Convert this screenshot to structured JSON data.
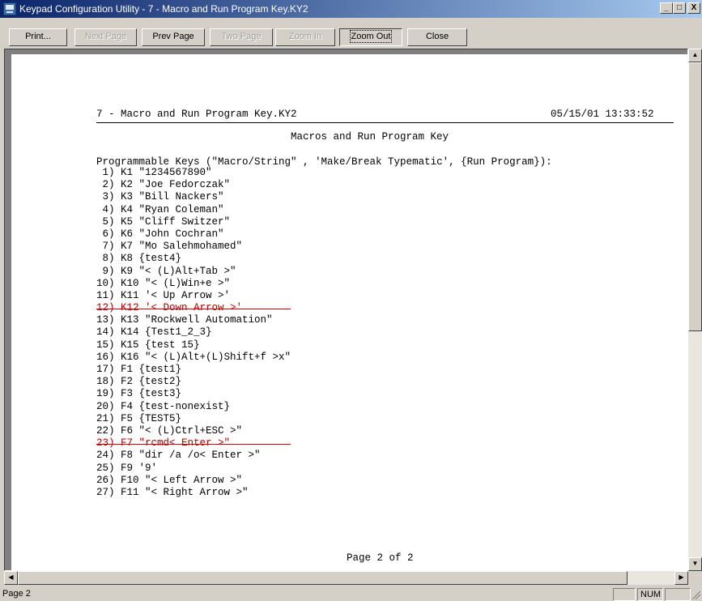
{
  "window": {
    "title": "Keypad Configuration Utility - 7 - Macro and Run Program Key.KY2",
    "controls": {
      "minimize": "_",
      "maximize": "□",
      "close": "X"
    }
  },
  "toolbar": {
    "buttons": [
      {
        "label": "Print...",
        "enabled": true
      },
      {
        "label": "Next Page",
        "enabled": false
      },
      {
        "label": "Prev Page",
        "enabled": true
      },
      {
        "label": "Two Page",
        "enabled": false
      },
      {
        "label": "Zoom In",
        "enabled": false
      },
      {
        "label": "Zoom Out",
        "enabled": true,
        "focused": true
      },
      {
        "label": "Close",
        "enabled": true
      }
    ]
  },
  "document": {
    "header_file": "7 - Macro and Run Program Key.KY2",
    "header_datetime": "05/15/01 13:33:52",
    "title": "Macros and Run Program Key",
    "programmable_heading": "Programmable Keys (\"Macro/String\" , 'Make/Break Typematic', {Run Program}):",
    "keys": [
      {
        "text": " 1) K1 \"1234567890\"",
        "struck": false
      },
      {
        "text": " 2) K2 \"Joe Fedorczak\"",
        "struck": false
      },
      {
        "text": " 3) K3 \"Bill Nackers\"",
        "struck": false
      },
      {
        "text": " 4) K4 \"Ryan Coleman\"",
        "struck": false
      },
      {
        "text": " 5) K5 \"Cliff Switzer\"",
        "struck": false
      },
      {
        "text": " 6) K6 \"John Cochran\"",
        "struck": false
      },
      {
        "text": " 7) K7 \"Mo Salehmohamed\"",
        "struck": false
      },
      {
        "text": " 8) K8 {test4}",
        "struck": false
      },
      {
        "text": " 9) K9 \"< (L)Alt+Tab >\"",
        "struck": false
      },
      {
        "text": "10) K10 \"< (L)Win+e >\"",
        "struck": false
      },
      {
        "text": "11) K11 '< Up Arrow >'",
        "struck": false
      },
      {
        "text": "12) K12 '< Down Arrow >'",
        "struck": true
      },
      {
        "text": "13) K13 \"Rockwell Automation\"",
        "struck": false
      },
      {
        "text": "14) K14 {Test1_2_3}",
        "struck": false
      },
      {
        "text": "15) K15 {test 15}",
        "struck": false
      },
      {
        "text": "16) K16 \"< (L)Alt+(L)Shift+f >x\"",
        "struck": false
      },
      {
        "text": "17) F1 {test1}",
        "struck": false
      },
      {
        "text": "18) F2 {test2}",
        "struck": false
      },
      {
        "text": "19) F3 {test3}",
        "struck": false
      },
      {
        "text": "20) F4 {test-nonexist}",
        "struck": false
      },
      {
        "text": "21) F5 {TEST5}",
        "struck": false
      },
      {
        "text": "22) F6 \"< (L)Ctrl+ESC >\"",
        "struck": false
      },
      {
        "text": "23) F7 \"rcmd< Enter >\"",
        "struck": true
      },
      {
        "text": "24) F8 \"dir /a /o< Enter >\"",
        "struck": false
      },
      {
        "text": "25) F9 '9'",
        "struck": false
      },
      {
        "text": "26) F10 \"< Left Arrow >\"",
        "struck": false
      },
      {
        "text": "27) F11 \"< Right Arrow >\"",
        "struck": false
      }
    ],
    "footer": "Page 2 of 2"
  },
  "statusbar": {
    "main": "Page 2",
    "num": "NUM"
  },
  "colors": {
    "titlebar_start": "#0a246a",
    "titlebar_end": "#a6caf0",
    "strike": "#d00000"
  }
}
